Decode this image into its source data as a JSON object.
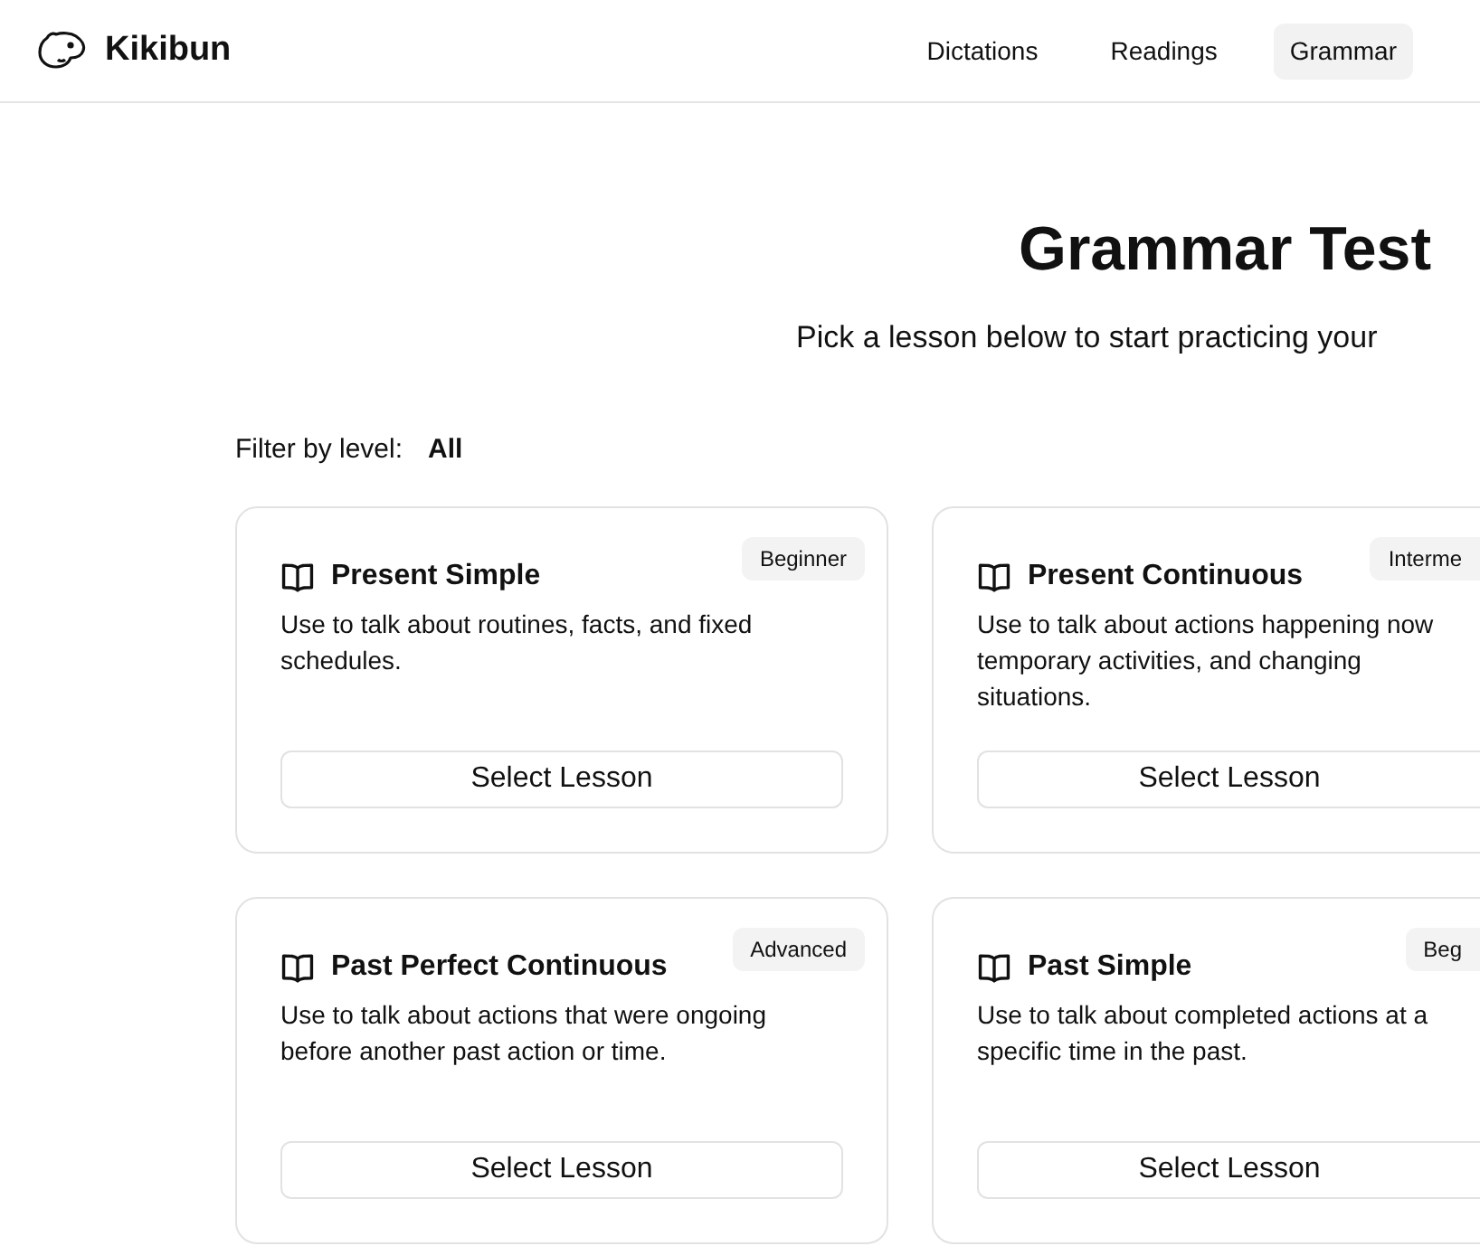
{
  "header": {
    "brand": "Kikibun",
    "nav": [
      {
        "label": "Dictations",
        "selected": false
      },
      {
        "label": "Readings",
        "selected": false
      },
      {
        "label": "Grammar",
        "selected": true
      }
    ]
  },
  "title": "Grammar Test",
  "subtitle": "Pick a lesson below to start practicing your",
  "filter": {
    "label": "Filter by level:",
    "value": "All"
  },
  "lessons": [
    {
      "title": "Present Simple",
      "level": "Beginner",
      "description": "Use to talk about routines, facts, and fixed schedules.",
      "button": "Select Lesson"
    },
    {
      "title": "Present Continuous",
      "level": "Interme",
      "description": "Use to talk about actions happening now temporary activities, and changing situations.",
      "button": "Select Lesson"
    },
    {
      "title": "Past Perfect Continuous",
      "level": "Advanced",
      "description": "Use to talk about actions that were ongoing before another past action or time.",
      "button": "Select Lesson"
    },
    {
      "title": "Past Simple",
      "level": "Beg",
      "description": "Use to talk about completed actions at a specific time in the past.",
      "button": "Select Lesson"
    }
  ]
}
